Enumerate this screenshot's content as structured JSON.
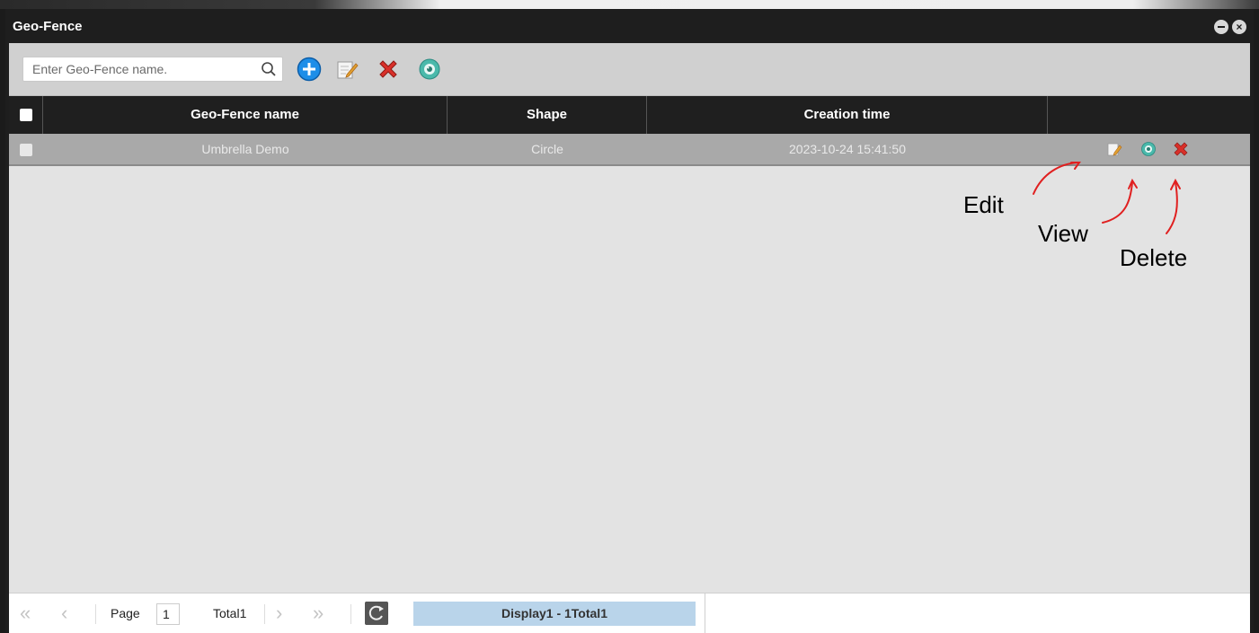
{
  "window": {
    "title": "Geo-Fence"
  },
  "search": {
    "placeholder": "Enter Geo-Fence name."
  },
  "toolbar": {
    "icons": [
      "search-icon",
      "add-icon",
      "edit-icon",
      "delete-icon",
      "view-icon"
    ]
  },
  "table": {
    "columns": [
      "Geo-Fence name",
      "Shape",
      "Creation time",
      ""
    ],
    "rows": [
      {
        "name": "Umbrella Demo",
        "shape": "Circle",
        "created": "2023-10-24 15:41:50",
        "actions": [
          "edit-icon",
          "view-icon",
          "delete-icon"
        ]
      }
    ]
  },
  "annotations": {
    "edit": "Edit",
    "view": "View",
    "delete": "Delete"
  },
  "pagination": {
    "page_label": "Page",
    "page_value": "1",
    "total_label": "Total1",
    "display_info": "Display1 - 1Total1"
  },
  "colors": {
    "header_bg": "#1f1f1f",
    "row_selected": "#a9a9a9",
    "add_blue": "#1e8ee8",
    "delete_red": "#d9302a",
    "view_teal": "#4ab9ab",
    "annotation_red": "#e02020",
    "display_bg": "#b9d4ea"
  }
}
